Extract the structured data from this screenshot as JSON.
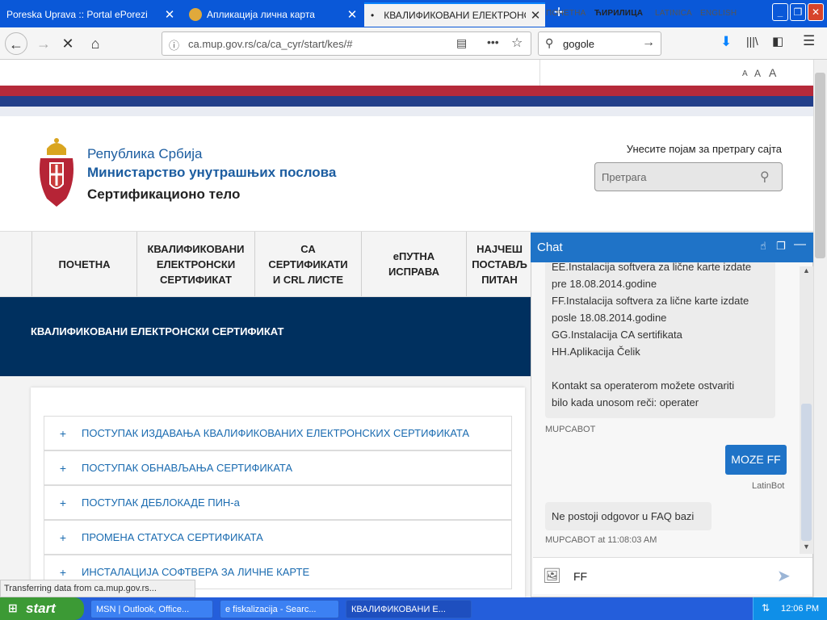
{
  "browser": {
    "tabs": [
      {
        "title": "Poreska Uprava :: Portal ePorezi",
        "active": false
      },
      {
        "title": "Апликација лична карта",
        "active": false
      },
      {
        "title": "КВАЛИФИКОВАНИ ЕЛЕКТРОНСКИ",
        "active": true
      }
    ],
    "url": "ca.mup.gov.rs/ca/ca_cyr/start/kes/#",
    "search_value": "gogole"
  },
  "site": {
    "languages": [
      "ПОЧЕТНА",
      "ЋИРИЛИЦА",
      "LATINICA",
      "ENGLISH"
    ],
    "font_sizes": [
      "A",
      "A",
      "A"
    ],
    "org_line1": "Република Србија",
    "org_line2": "Министарство унутрашњих послова",
    "org_line3": "Сертификационо тело",
    "search_label": "Унесите појам за претрагу сајта",
    "search_placeholder": "Претрага",
    "menu": [
      "ПОЧЕТНА",
      "КВАЛИФИКОВАНИ ЕЛЕКТРОНСКИ СЕРТИФИКАТ",
      "СА СЕРТИФИКАТИ И CRL ЛИСТЕ",
      "еПУТНА ИСПРАВА",
      "НАЈЧЕШ ПОСТАВЉ ПИТАН"
    ],
    "page_title": "КВАЛИФИКОВАНИ ЕЛЕКТРОНСКИ СЕРТИФИКАТ",
    "accordion": [
      "ПОСТУПАК ИЗДАВАЊА КВАЛИФИКОВАНИХ ЕЛЕКТРОНСКИХ СЕРТИФИКАТА",
      "ПОСТУПАК ОБНАВЉАЊА СЕРТИФИКАТА",
      "ПОСТУПАК ДЕБЛОКАДЕ ПИН-а",
      "ПРОМЕНА СТАТУСА СЕРТИФИКАТА",
      "ИНСТАЛАЦИЈА СОФТВЕРА ЗА ЛИЧНЕ КАРТЕ"
    ]
  },
  "chat": {
    "title": "Chat",
    "bot_lines": [
      "EE.Instalacija softvera za lične karte izdate",
      "pre 18.08.2014.godine",
      "FF.Instalacija softvera za lične karte izdate",
      "posle 18.08.2014.godine",
      "GG.Instalacija CA sertifikata",
      "HH.Aplikacija Čelik",
      "",
      "Kontakt sa operaterom možete ostvariti",
      "bilo kada unosom reči: operater"
    ],
    "bot_name": "MUPCABOT",
    "user_message": "MOZE FF",
    "user_name": "LatinBot",
    "bot_reply": "Ne postoji odgovor u FAQ bazi",
    "bot_reply_meta": "MUPCABOT at 11:08:03 AM",
    "input_value": "FF"
  },
  "status_text": "Transferring data from ca.mup.gov.rs...",
  "taskbar": {
    "start": "start",
    "tasks": [
      "MSN | Outlook, Office...",
      "e fiskalizacija - Searc...",
      "КВАЛИФИКОВАНИ Е..."
    ],
    "clock": "12:06 PM"
  },
  "colors": {
    "brand_blue": "#00305f",
    "chat_blue": "#1f73c7",
    "flag_red": "#b52a3a"
  }
}
